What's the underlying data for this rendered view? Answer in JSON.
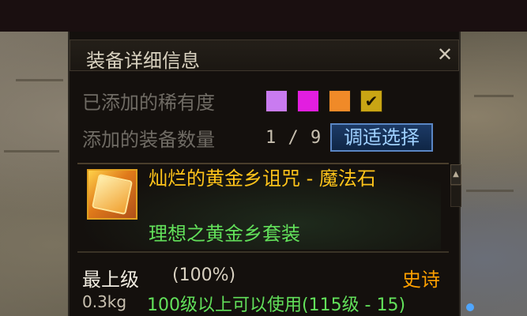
{
  "window": {
    "title": "装备详细信息",
    "close_glyph": "✕"
  },
  "filters": {
    "rarity_label": "已添加的稀有度",
    "count_label": "添加的装备数量",
    "count_value": "1 / 9",
    "select_button": "调适选择",
    "rarity_colors": [
      "#c97bf0",
      "#e21ee0",
      "#f08a28",
      "#c9a514"
    ],
    "selected_indicator": "check-icon"
  },
  "item": {
    "name": "灿烂的黄金乡诅咒 - 魔法石",
    "set_name": "理想之黄金乡套装",
    "grade": "最上级",
    "grade_percent": "(100%)",
    "rarity": "史诗",
    "weight": "0.3kg",
    "level_requirement": "100级以上可以使用(115级 - 15)"
  },
  "scroll": {
    "up_glyph": "▲"
  }
}
